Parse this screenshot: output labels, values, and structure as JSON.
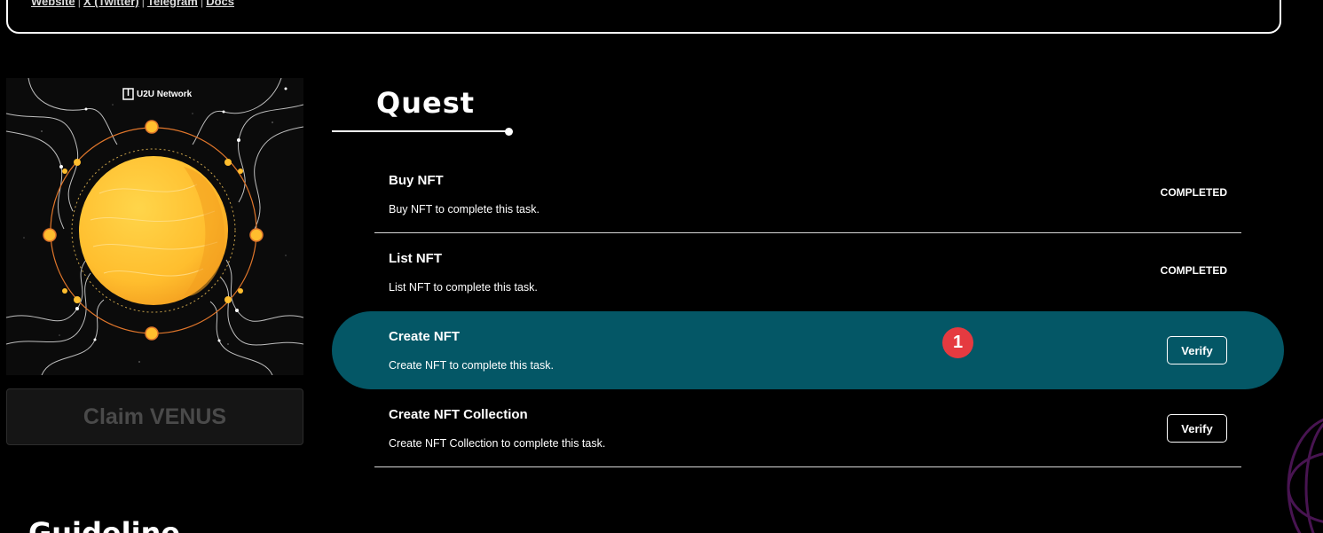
{
  "links": [
    "Website",
    "X (Twitter)",
    "Telegram",
    "Docs"
  ],
  "link_separator": "|",
  "artwork": {
    "brand_text": "U2U Network",
    "brand_icon": "u2u-logo",
    "colors": {
      "planet": "#FFBE2E",
      "orbit": "#E0762B",
      "lines": "#cfcfcf"
    }
  },
  "claim_button": {
    "label": "Claim VENUS"
  },
  "quest": {
    "title": "Quest",
    "tasks": [
      {
        "title": "Buy NFT",
        "description": "Buy NFT to complete this task.",
        "status": "COMPLETED"
      },
      {
        "title": "List NFT",
        "description": "List NFT to complete this task.",
        "status": "COMPLETED"
      },
      {
        "title": "Create NFT",
        "description": "Create NFT to complete this task.",
        "action": "Verify"
      },
      {
        "title": "Create NFT Collection",
        "description": "Create NFT Collection to complete this task.",
        "action": "Verify"
      }
    ],
    "highlight_color": "#045766"
  },
  "annotation_badge": "1",
  "guideline_title": "Guideline"
}
